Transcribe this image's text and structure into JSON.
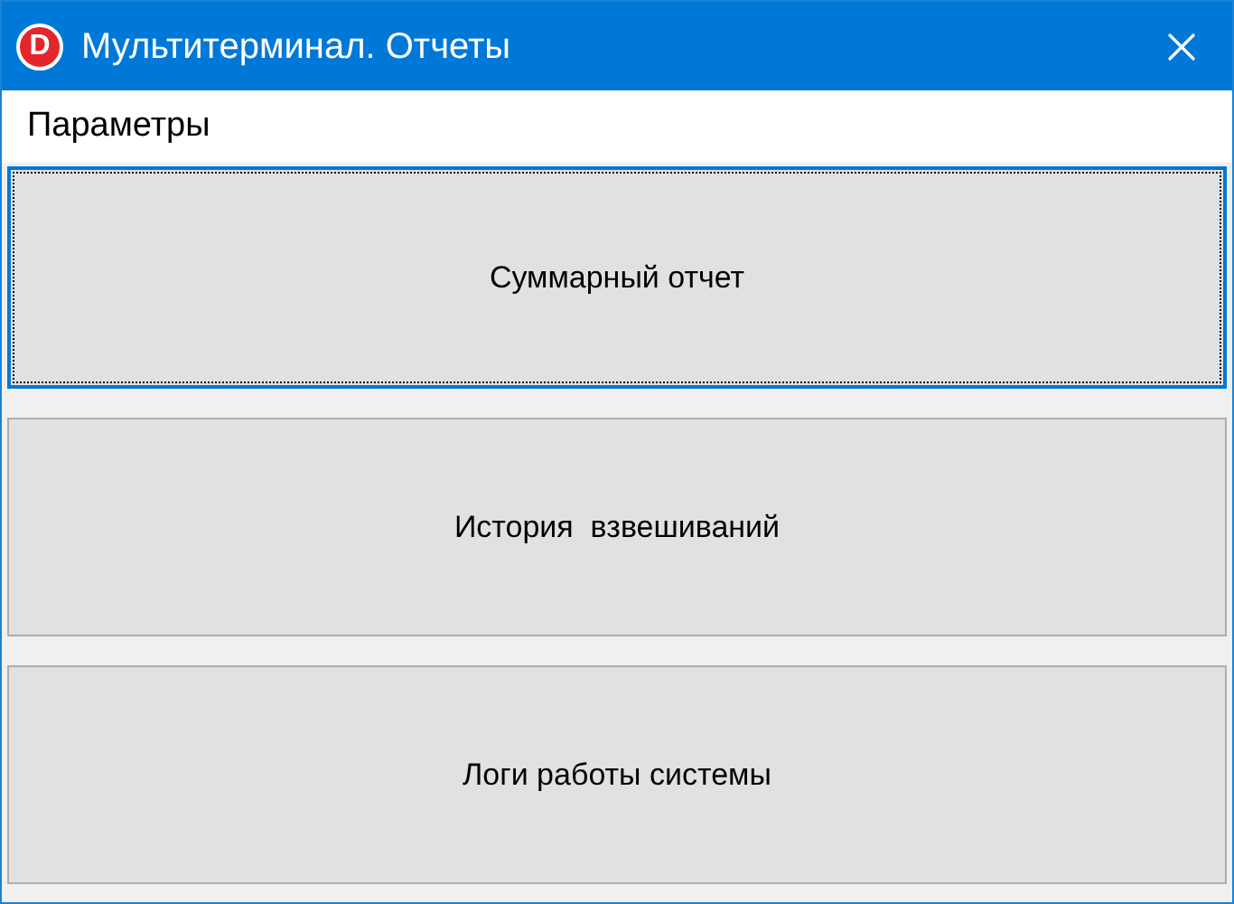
{
  "window": {
    "logo": "D",
    "title": "Мультитерминал. Отчеты"
  },
  "menu": [
    "Параметры"
  ],
  "buttons": [
    {
      "label": "Суммарный отчет",
      "focused": true
    },
    {
      "label": "История  взвешиваний",
      "focused": false
    },
    {
      "label": "Логи работы системы",
      "focused": false
    }
  ]
}
